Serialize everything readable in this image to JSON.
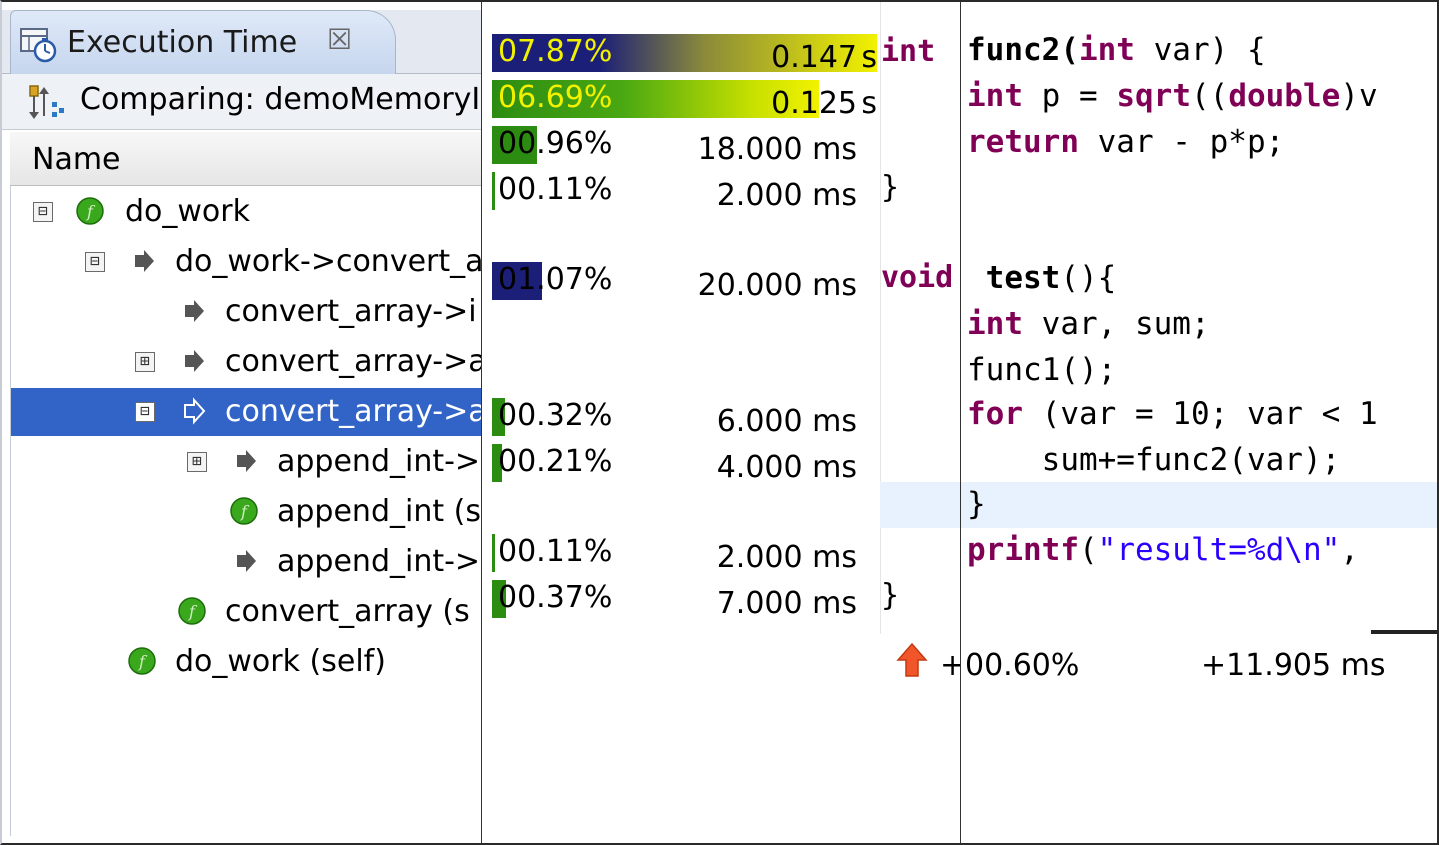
{
  "view_tab": {
    "title": "Execution Time",
    "close_symbol": "☒"
  },
  "comparing": "Comparing: demoMemoryI",
  "column_header": "Name",
  "tree": [
    {
      "label": "do_work",
      "toggle": "⊟",
      "icon": "function-icon"
    },
    {
      "label": "do_work->convert_a",
      "toggle": "⊟",
      "icon": "call-arrow-icon"
    },
    {
      "label": "convert_array->i",
      "toggle": "",
      "icon": "call-arrow-icon"
    },
    {
      "label": "convert_array->a",
      "toggle": "⊞",
      "icon": "call-arrow-icon"
    },
    {
      "label": "convert_array->a",
      "toggle": "⊟",
      "icon": "call-arrow-icon",
      "selected": true
    },
    {
      "label": "append_int->",
      "toggle": "⊞",
      "icon": "call-arrow-icon"
    },
    {
      "label": "append_int (s",
      "toggle": "",
      "icon": "function-icon"
    },
    {
      "label": "append_int->",
      "toggle": "",
      "icon": "call-arrow-icon"
    },
    {
      "label": "convert_array (s",
      "toggle": "",
      "icon": "function-icon"
    },
    {
      "label": "do_work (self)",
      "toggle": "",
      "icon": "function-icon"
    }
  ],
  "stats": [
    {
      "pct": "07.87%",
      "value": "0.147",
      "unit": "s",
      "fraction": 0.0787,
      "style": "gradient-navy-yellow"
    },
    {
      "pct": "06.69%",
      "value": "0.125",
      "unit": "s",
      "fraction": 0.0669,
      "style": "gradient-green-yellow"
    },
    {
      "pct": "00.96%",
      "value": "18.000 ms",
      "unit": "",
      "fraction": 0.0096,
      "style": "green"
    },
    {
      "pct": "00.11%",
      "value": "2.000 ms",
      "unit": "",
      "fraction": 0.0011,
      "style": "green"
    },
    {
      "pct": "01.07%",
      "value": "20.000 ms",
      "unit": "",
      "fraction": 0.0107,
      "style": "navy"
    },
    {
      "pct": "00.32%",
      "value": "6.000 ms",
      "unit": "",
      "fraction": 0.0032,
      "style": "green"
    },
    {
      "pct": "00.21%",
      "value": "4.000 ms",
      "unit": "",
      "fraction": 0.0021,
      "style": "green"
    },
    {
      "pct": "00.11%",
      "value": "2.000 ms",
      "unit": "",
      "fraction": 0.0011,
      "style": "green"
    },
    {
      "pct": "00.37%",
      "value": "7.000 ms",
      "unit": "",
      "fraction": 0.0037,
      "style": "green"
    }
  ],
  "mid_code": {
    "int_kw": "int",
    "brace1": "}",
    "void_kw": "void",
    "brace2": "}"
  },
  "code": {
    "l1_fn": "func2(",
    "l1_kw": "int",
    "l1_rest": " var) {",
    "l2_kw": "int",
    "l2_mid": " p = ",
    "l2_fn": "sqrt",
    "l2_paren": "((",
    "l2_kw2": "double",
    "l2_rest": ")v",
    "l3_kw": "return",
    "l3_rest": " var - p*p;",
    "l4_fn": " test",
    "l4_rest": "(){",
    "l5_kw": "int",
    "l5_rest": " var, sum;",
    "l6": "func1();",
    "l7_kw": "for",
    "l7_rest": " (var = 10; var < 1",
    "l8": "    sum+=func2(var);",
    "l9": "}",
    "l10_fn": "printf",
    "l10_open": "(",
    "l10_str": "\"result=%d\\n\"",
    "l10_rest": ", "
  },
  "summary": {
    "arrow": "up-red-arrow-icon",
    "plus": "+",
    "pct": "00.60%",
    "ms": "+11.905 ms"
  },
  "colors": {
    "selection": "#3164c6",
    "keyword": "#7f0055",
    "string": "#2a00ff",
    "bar_navy": "#1c1f78",
    "bar_green": "#2c8c12",
    "bar_yellow": "#f2f200",
    "icon_green": "#3aa81c"
  }
}
